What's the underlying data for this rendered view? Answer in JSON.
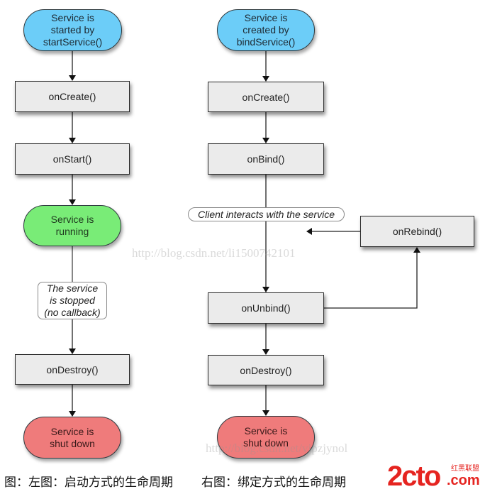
{
  "colors": {
    "start_node": "#6ccdf8",
    "running_node": "#79ec77",
    "shutdown_node": "#ef7b7b",
    "process_box": "#ebebeb",
    "logo_red": "#e52420"
  },
  "left_flow": {
    "start": "Service is\nstarted by\nstartService()",
    "on_create": "onCreate()",
    "on_start": "onStart()",
    "running": "Service is\nrunning",
    "stopped_note": "The service\nis stopped\n(no callback)",
    "on_destroy": "onDestroy()",
    "shutdown": "Service is\nshut down"
  },
  "right_flow": {
    "start": "Service is\ncreated by\nbindService()",
    "on_create": "onCreate()",
    "on_bind": "onBind()",
    "client_label": "Client interacts with the service",
    "on_rebind": "onRebind()",
    "on_unbind": "onUnbind()",
    "on_destroy": "onDestroy()",
    "shutdown": "Service is\nshut down"
  },
  "watermarks": {
    "middle": "http://blog.csdn.net/li1500742101",
    "bottom": "http://blog.csdn.net/vipzjynol"
  },
  "caption": {
    "left": "图：左图：启动方式的生命周期",
    "right": "右图：绑定方式的生命周期"
  },
  "logo": {
    "main": "2cto",
    "sub": "红黑联盟",
    "domain": ".com"
  }
}
